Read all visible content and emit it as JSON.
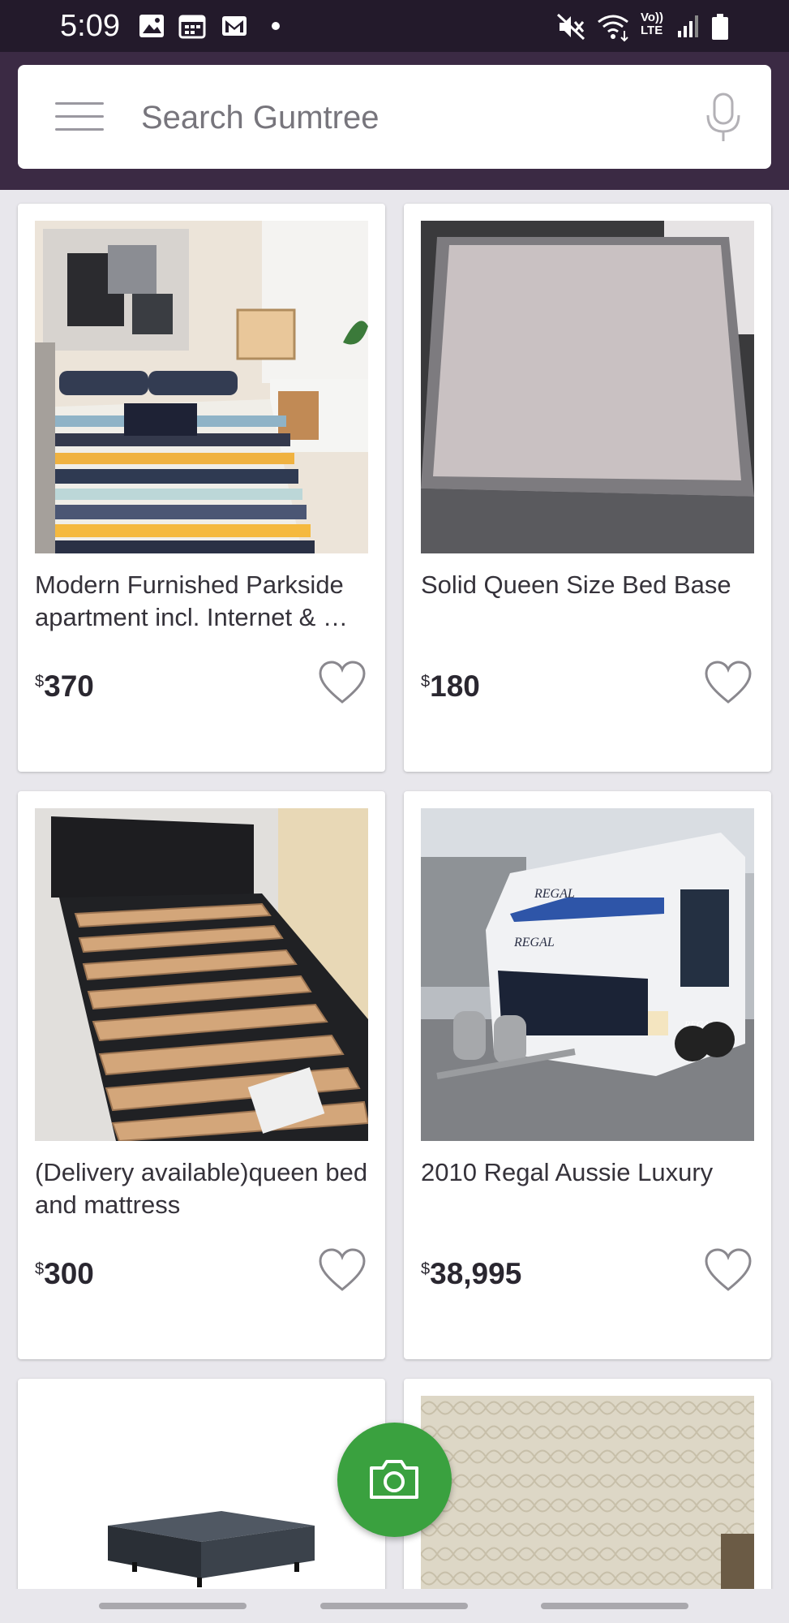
{
  "status_bar": {
    "time": "5:09",
    "left_icons": [
      "image-icon",
      "calendar-icon",
      "gmail-icon",
      "dot-icon"
    ],
    "right_icons": [
      "mute-icon",
      "wifi-icon",
      "volte-icon",
      "signal-icon",
      "battery-icon"
    ],
    "volte_label_top": "Vo))",
    "volte_label_bottom": "LTE"
  },
  "header": {
    "background": "#3b2a44",
    "search": {
      "placeholder": "Search Gumtree",
      "value": ""
    },
    "menu_icon": "hamburger-icon",
    "mic_icon": "microphone-icon"
  },
  "listings": [
    {
      "title": "Modern Furnished Parkside apartment incl. Internet & …",
      "currency": "$",
      "price": "370",
      "favorite": false,
      "image": "bedroom-photo"
    },
    {
      "title": "Solid Queen Size Bed Base",
      "currency": "$",
      "price": "180",
      "favorite": false,
      "image": "bed-base-photo"
    },
    {
      "title": "(Delivery available)queen bed and mattress",
      "currency": "$",
      "price": "300",
      "favorite": false,
      "image": "bed-frame-photo"
    },
    {
      "title": "2010 Regal Aussie Luxury",
      "currency": "$",
      "price": "38,995",
      "favorite": false,
      "image": "caravan-photo",
      "image_text": [
        "REGAL",
        "REGAL",
        "REGAL"
      ]
    },
    {
      "title": "",
      "currency": "$",
      "price": "",
      "favorite": false,
      "image": "ensemble-base-photo"
    },
    {
      "title": "",
      "currency": "$",
      "price": "",
      "favorite": false,
      "image": "mattress-photo"
    }
  ],
  "fab": {
    "icon": "camera-icon",
    "color": "#3aa13f"
  },
  "colors": {
    "status_bar": "#231a2b",
    "page_bg": "#e8e7ec",
    "card_bg": "#ffffff"
  }
}
